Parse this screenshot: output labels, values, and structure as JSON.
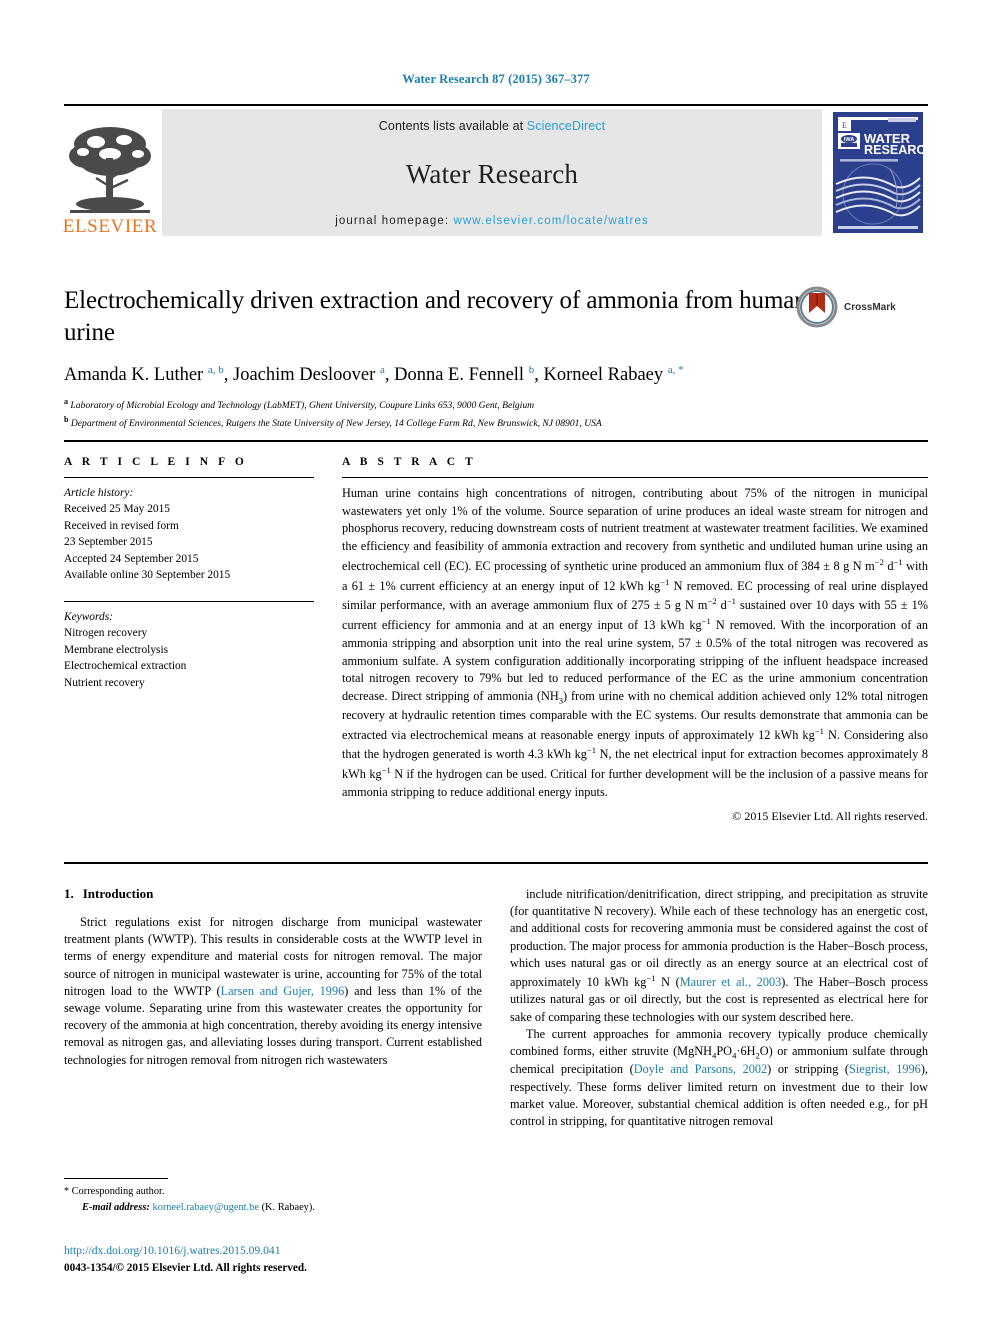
{
  "running_head": "Water Research 87 (2015) 367–377",
  "masthead": {
    "contents_prefix": "Contents lists available at ",
    "sciencedirect": "ScienceDirect",
    "journal_name": "Water Research",
    "homepage_prefix": "journal homepage: ",
    "homepage_url": "www.elsevier.com/locate/watres",
    "elsevier_wordmark": "ELSEVIER",
    "cover_title_line1": "WATER",
    "cover_title_line2": "RESEARCH",
    "cover_badge": "IWA"
  },
  "article": {
    "title": "Electrochemically driven extraction and recovery of ammonia from human urine",
    "crossmark_label": "CrossMark",
    "authors_html": "Amanda K. Luther <sup>a, b</sup>, Joachim Desloover <sup>a</sup>, Donna E. Fennell <sup>b</sup>, Korneel Rabaey <sup>a, *</sup>",
    "affiliations": [
      {
        "marker": "a",
        "text": "Laboratory of Microbial Ecology and Technology (LabMET), Ghent University, Coupure Links 653, 9000 Gent, Belgium"
      },
      {
        "marker": "b",
        "text": "Department of Environmental Sciences, Rutgers the State University of New Jersey, 14 College Farm Rd, New Brunswick, NJ 08901, USA"
      }
    ]
  },
  "article_info": {
    "heading": "A R T I C L E   I N F O",
    "history_label": "Article history:",
    "history": [
      "Received 25 May 2015",
      "Received in revised form",
      "23 September 2015",
      "Accepted 24 September 2015",
      "Available online 30 September 2015"
    ],
    "keywords_label": "Keywords:",
    "keywords": [
      "Nitrogen recovery",
      "Membrane electrolysis",
      "Electrochemical extraction",
      "Nutrient recovery"
    ]
  },
  "abstract": {
    "heading": "A B S T R A C T",
    "text_html": "Human urine contains high concentrations of nitrogen, contributing about 75% of the nitrogen in municipal wastewaters yet only 1% of the volume. Source separation of urine produces an ideal waste stream for nitrogen and phosphorus recovery, reducing downstream costs of nutrient treatment at wastewater treatment facilities. We examined the efficiency and feasibility of ammonia extraction and recovery from synthetic and undiluted human urine using an electrochemical cell (EC). EC processing of synthetic urine produced an ammonium flux of 384 &plusmn; 8 g N m<sup>&minus;2</sup> d<sup>&minus;1</sup> with a 61 &plusmn; 1% current efficiency at an energy input of 12 kWh kg<sup>&minus;1</sup> N removed. EC processing of real urine displayed similar performance, with an average ammonium flux of 275 &plusmn; 5 g N m<sup>&minus;2</sup> d<sup>&minus;1</sup> sustained over 10 days with 55 &plusmn; 1% current efficiency for ammonia and at an energy input of 13 kWh kg<sup>&minus;1</sup> N removed. With the incorporation of an ammonia stripping and absorption unit into the real urine system, 57 &plusmn; 0.5% of the total nitrogen was recovered as ammonium sulfate. A system configuration additionally incorporating stripping of the influent headspace increased total nitrogen recovery to 79% but led to reduced performance of the EC as the urine ammonium concentration decrease. Direct stripping of ammonia (NH<sub>3</sub>) from urine with no chemical addition achieved only 12% total nitrogen recovery at hydraulic retention times comparable with the EC systems. Our results demonstrate that ammonia can be extracted via electrochemical means at reasonable energy inputs of approximately 12 kWh kg<sup>&minus;1</sup> N. Considering also that the hydrogen generated is worth 4.3 kWh kg<sup>&minus;1</sup> N, the net electrical input for extraction becomes approximately 8 kWh kg<sup>&minus;1</sup> N if the hydrogen can be used. Critical for further development will be the inclusion of a passive means for ammonia stripping to reduce additional energy inputs.",
    "copyright": "© 2015 Elsevier Ltd. All rights reserved."
  },
  "introduction": {
    "section_number": "1.",
    "section_title": "Introduction",
    "left_paragraphs_html": [
      "Strict regulations exist for nitrogen discharge from municipal wastewater treatment plants (WWTP). This results in considerable costs at the WWTP level in terms of energy expenditure and material costs for nitrogen removal. The major source of nitrogen in municipal wastewater is urine, accounting for 75% of the total nitrogen load to the WWTP (<span class=\"cite\">Larsen and Gujer, 1996</span>) and less than 1% of the sewage volume. Separating urine from this wastewater creates the opportunity for recovery of the ammonia at high concentration, thereby avoiding its energy intensive removal as nitrogen gas, and alleviating losses during transport. Current established technologies for nitrogen removal from nitrogen rich wastewaters"
    ],
    "right_paragraphs_html": [
      "include nitrification/denitrification, direct stripping, and precipitation as struvite (for quantitative N recovery). While each of these technology has an energetic cost, and additional costs for recovering ammonia must be considered against the cost of production. The major process for ammonia production is the Haber&ndash;Bosch process, which uses natural gas or oil directly as an energy source at an electrical cost of approximately 10 kWh kg<sup>&minus;1</sup> N (<span class=\"cite\">Maurer et al., 2003</span>). The Haber&ndash;Bosch process utilizes natural gas or oil directly, but the cost is represented as electrical here for sake of comparing these technologies with our system described here.",
      "The current approaches for ammonia recovery typically produce chemically combined forms, either struvite (MgNH<sub>4</sub>PO<sub>4</sub>&middot;6H<sub>2</sub>O) or ammonium sulfate through chemical precipitation (<span class=\"cite\">Doyle and Parsons, 2002</span>) or stripping (<span class=\"cite\">Siegrist, 1996</span>), respectively. These forms deliver limited return on investment due to their low market value. Moreover, substantial chemical addition is often needed e.g., for pH control in stripping, for quantitative nitrogen removal"
    ]
  },
  "footnote": {
    "corresponding_marker": "*",
    "corresponding_text": "Corresponding author.",
    "email_label": "E-mail address:",
    "email": "korneel.rabaey@ugent.be",
    "email_owner": "(K. Rabaey)."
  },
  "doi": {
    "url": "http://dx.doi.org/10.1016/j.watres.2015.09.041",
    "issn_line": "0043-1354/© 2015 Elsevier Ltd. All rights reserved."
  },
  "colors": {
    "link_blue": "#1b7fa8",
    "sciencedirect_blue": "#2a9fd6",
    "elsevier_orange": "#e87722",
    "cover_blue": "#2b3f8c"
  }
}
